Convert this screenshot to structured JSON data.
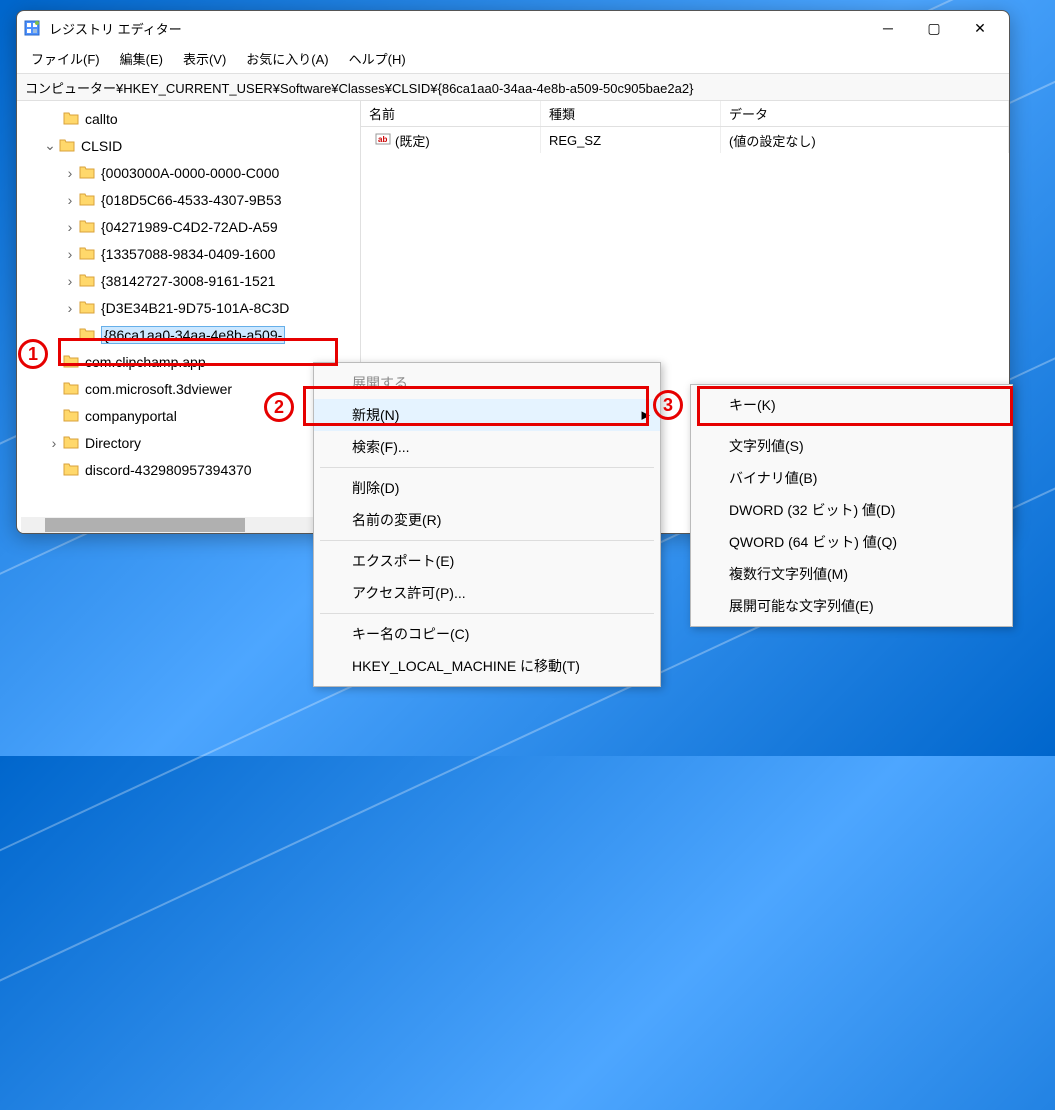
{
  "window": {
    "title": "レジストリ エディター",
    "address": "コンピューター¥HKEY_CURRENT_USER¥Software¥Classes¥CLSID¥{86ca1aa0-34aa-4e8b-a509-50c905bae2a2}"
  },
  "menubar": [
    "ファイル(F)",
    "編集(E)",
    "表示(V)",
    "お気に入り(A)",
    "ヘルプ(H)"
  ],
  "tree": [
    {
      "label": "callto",
      "indent": "indent0",
      "exp": "none",
      "sel": false
    },
    {
      "label": "CLSID",
      "indent": "indent1",
      "exp": "expanded",
      "sel": false
    },
    {
      "label": "{0003000A-0000-0000-C000",
      "indent": "indent2",
      "exp": "collapsed",
      "sel": false
    },
    {
      "label": "{018D5C66-4533-4307-9B53",
      "indent": "indent2",
      "exp": "collapsed",
      "sel": false
    },
    {
      "label": "{04271989-C4D2-72AD-A59",
      "indent": "indent2",
      "exp": "collapsed",
      "sel": false
    },
    {
      "label": "{13357088-9834-0409-1600",
      "indent": "indent2",
      "exp": "collapsed",
      "sel": false
    },
    {
      "label": "{38142727-3008-9161-1521",
      "indent": "indent2",
      "exp": "collapsed",
      "sel": false
    },
    {
      "label": "{D3E34B21-9D75-101A-8C3D",
      "indent": "indent2",
      "exp": "collapsed",
      "sel": false
    },
    {
      "label": "{86ca1aa0-34aa-4e8b-a509-",
      "indent": "indent2",
      "exp": "none",
      "sel": true
    },
    {
      "label": "com.clipchamp.app",
      "indent": "indent0",
      "exp": "none",
      "sel": false
    },
    {
      "label": "com.microsoft.3dviewer",
      "indent": "indent0",
      "exp": "none",
      "sel": false
    },
    {
      "label": "companyportal",
      "indent": "indent0",
      "exp": "none",
      "sel": false
    },
    {
      "label": "Directory",
      "indent": "indent0",
      "exp": "collapsed",
      "sel": false
    },
    {
      "label": "discord-432980957394370",
      "indent": "indent0",
      "exp": "none",
      "sel": false
    }
  ],
  "list": {
    "headers": {
      "name": "名前",
      "type": "種類",
      "data": "データ"
    },
    "rows": [
      {
        "name": "(既定)",
        "type": "REG_SZ",
        "data": "(値の設定なし)"
      }
    ]
  },
  "context1": [
    {
      "label": "展開する",
      "disabled": true
    },
    {
      "label": "新規(N)",
      "hover": true,
      "submenu": true
    },
    {
      "label": "検索(F)..."
    },
    {
      "sep": true
    },
    {
      "label": "削除(D)"
    },
    {
      "label": "名前の変更(R)"
    },
    {
      "sep": true
    },
    {
      "label": "エクスポート(E)"
    },
    {
      "label": "アクセス許可(P)..."
    },
    {
      "sep": true
    },
    {
      "label": "キー名のコピー(C)"
    },
    {
      "label": "HKEY_LOCAL_MACHINE に移動(T)"
    }
  ],
  "context2": [
    {
      "label": "キー(K)"
    },
    {
      "sep": true
    },
    {
      "label": "文字列値(S)"
    },
    {
      "label": "バイナリ値(B)"
    },
    {
      "label": "DWORD (32 ビット) 値(D)"
    },
    {
      "label": "QWORD (64 ビット) 値(Q)"
    },
    {
      "label": "複数行文字列値(M)"
    },
    {
      "label": "展開可能な文字列値(E)"
    }
  ],
  "annotations": {
    "n1": "1",
    "n2": "2",
    "n3": "3"
  }
}
